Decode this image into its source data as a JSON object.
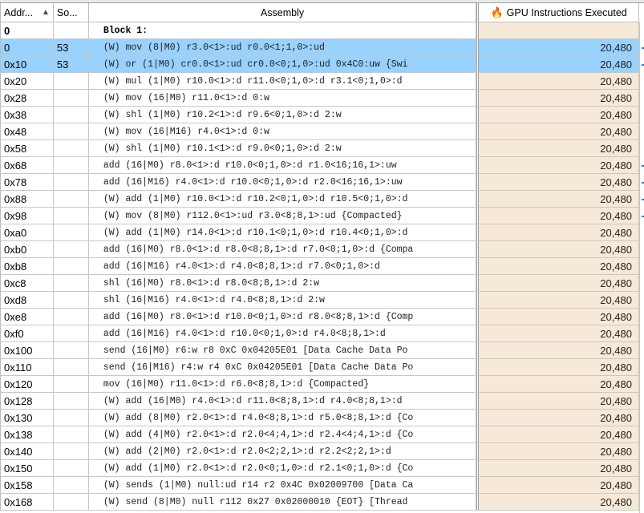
{
  "columns": {
    "address": "Addr...",
    "source": "So...",
    "assembly": "Assembly",
    "gpu": "GPU Instructions Executed"
  },
  "icons": {
    "sort": "sort-ascending-icon",
    "hotspot": "flame-icon"
  },
  "colors": {
    "selection": "#99d1ff",
    "metric_bg": "#f7e9d7",
    "flame": "#e07a10"
  },
  "rows": [
    {
      "addr": "0",
      "src": "",
      "asm": "Block 1:",
      "gpu": "",
      "block": true
    },
    {
      "addr": "0",
      "src": "53",
      "asm": "(W) mov (8|M0) r3.0<1>:ud r0.0<1;1,0>:ud",
      "gpu": "20,480",
      "selected": true
    },
    {
      "addr": "0x10",
      "src": "53",
      "asm": "(W) or (1|M0) cr0.0<1>:ud cr0.0<0;1,0>:ud 0x4C0:uw {Swi",
      "gpu": "20,480",
      "selected": true
    },
    {
      "addr": "0x20",
      "src": "",
      "asm": "(W) mul (1|M0) r10.0<1>:d r11.0<0;1,0>:d r3.1<0;1,0>:d",
      "gpu": "20,480"
    },
    {
      "addr": "0x28",
      "src": "",
      "asm": "(W) mov (16|M0) r11.0<1>:d 0:w",
      "gpu": "20,480"
    },
    {
      "addr": "0x38",
      "src": "",
      "asm": "(W) shl (1|M0) r10.2<1>:d r9.6<0;1,0>:d 2:w",
      "gpu": "20,480"
    },
    {
      "addr": "0x48",
      "src": "",
      "asm": "(W) mov (16|M16) r4.0<1>:d 0:w",
      "gpu": "20,480"
    },
    {
      "addr": "0x58",
      "src": "",
      "asm": "(W) shl (1|M0) r10.1<1>:d r9.0<0;1,0>:d 2:w",
      "gpu": "20,480"
    },
    {
      "addr": "0x68",
      "src": "",
      "asm": "add (16|M0) r8.0<1>:d r10.0<0;1,0>:d r1.0<16;16,1>:uw",
      "gpu": "20,480"
    },
    {
      "addr": "0x78",
      "src": "",
      "asm": "add (16|M16) r4.0<1>:d r10.0<0;1,0>:d r2.0<16;16,1>:uw",
      "gpu": "20,480"
    },
    {
      "addr": "0x88",
      "src": "",
      "asm": "(W) add (1|M0) r10.0<1>:d r10.2<0;1,0>:d r10.5<0;1,0>:d",
      "gpu": "20,480"
    },
    {
      "addr": "0x98",
      "src": "",
      "asm": "(W) mov (8|M0) r112.0<1>:ud r3.0<8;8,1>:ud {Compacted}",
      "gpu": "20,480"
    },
    {
      "addr": "0xa0",
      "src": "",
      "asm": "(W) add (1|M0) r14.0<1>:d r10.1<0;1,0>:d r10.4<0;1,0>:d",
      "gpu": "20,480"
    },
    {
      "addr": "0xb0",
      "src": "",
      "asm": "add (16|M0) r8.0<1>:d r8.0<8;8,1>:d r7.0<0;1,0>:d {Compa",
      "gpu": "20,480"
    },
    {
      "addr": "0xb8",
      "src": "",
      "asm": "add (16|M16) r4.0<1>:d r4.0<8;8,1>:d r7.0<0;1,0>:d",
      "gpu": "20,480"
    },
    {
      "addr": "0xc8",
      "src": "",
      "asm": "shl (16|M0) r8.0<1>:d r8.0<8;8,1>:d 2:w",
      "gpu": "20,480"
    },
    {
      "addr": "0xd8",
      "src": "",
      "asm": "shl (16|M16) r4.0<1>:d r4.0<8;8,1>:d 2:w",
      "gpu": "20,480"
    },
    {
      "addr": "0xe8",
      "src": "",
      "asm": "add (16|M0) r8.0<1>:d r10.0<0;1,0>:d r8.0<8;8,1>:d {Comp",
      "gpu": "20,480"
    },
    {
      "addr": "0xf0",
      "src": "",
      "asm": "add (16|M16) r4.0<1>:d r10.0<0;1,0>:d r4.0<8;8,1>:d",
      "gpu": "20,480"
    },
    {
      "addr": "0x100",
      "src": "",
      "asm": "send (16|M0) r6:w r8 0xC 0x04205E01 [Data Cache Data Po",
      "gpu": "20,480"
    },
    {
      "addr": "0x110",
      "src": "",
      "asm": "send (16|M16) r4:w r4 0xC 0x04205E01 [Data Cache Data Po",
      "gpu": "20,480"
    },
    {
      "addr": "0x120",
      "src": "",
      "asm": "mov (16|M0) r11.0<1>:d r6.0<8;8,1>:d {Compacted}",
      "gpu": "20,480"
    },
    {
      "addr": "0x128",
      "src": "",
      "asm": "(W) add (16|M0) r4.0<1>:d r11.0<8;8,1>:d r4.0<8;8,1>:d",
      "gpu": "20,480"
    },
    {
      "addr": "0x130",
      "src": "",
      "asm": "(W) add (8|M0) r2.0<1>:d r4.0<8;8,1>:d r5.0<8;8,1>:d {Co",
      "gpu": "20,480"
    },
    {
      "addr": "0x138",
      "src": "",
      "asm": "(W) add (4|M0) r2.0<1>:d r2.0<4;4,1>:d r2.4<4;4,1>:d {Co",
      "gpu": "20,480"
    },
    {
      "addr": "0x140",
      "src": "",
      "asm": "(W) add (2|M0) r2.0<1>:d r2.0<2;2,1>:d r2.2<2;2,1>:d",
      "gpu": "20,480"
    },
    {
      "addr": "0x150",
      "src": "",
      "asm": "(W) add (1|M0) r2.0<1>:d r2.0<0;1,0>:d r2.1<0;1,0>:d {Co",
      "gpu": "20,480"
    },
    {
      "addr": "0x158",
      "src": "",
      "asm": "(W) sends (1|M0) null:ud r14 r2 0x4C 0x02009700 [Data Ca",
      "gpu": "20,480"
    },
    {
      "addr": "0x168",
      "src": "",
      "asm": "(W) send (8|M0) null r112 0x27 0x02000010 {EOT} [Thread",
      "gpu": "20,480"
    }
  ]
}
